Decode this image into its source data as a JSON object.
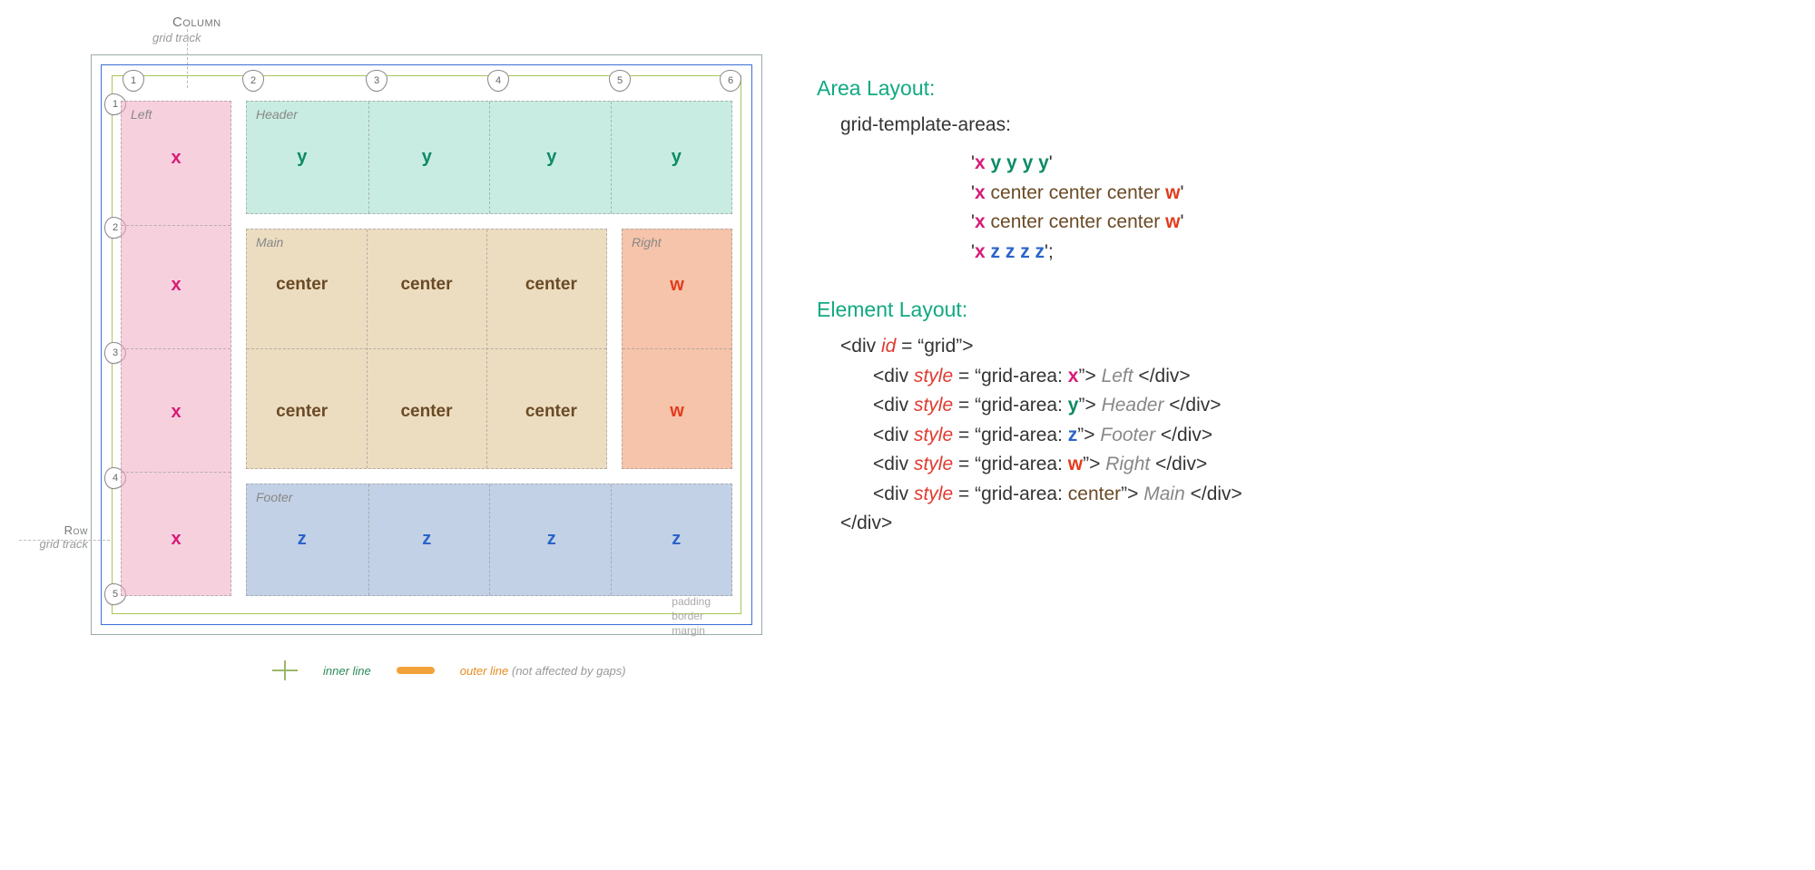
{
  "topLabels": {
    "column": "Column",
    "gridTrack": "grid track"
  },
  "rowLabels": {
    "row": "Row",
    "gridTrack": "grid track"
  },
  "columnNumbers": [
    "1",
    "2",
    "3",
    "4",
    "5",
    "6"
  ],
  "rowNumbers": [
    "1",
    "2",
    "3",
    "4",
    "5"
  ],
  "areas": {
    "left": {
      "title": "Left",
      "letter": "x",
      "rows": 4
    },
    "header": {
      "title": "Header",
      "letter": "y",
      "cols": 4
    },
    "main": {
      "title": "Main",
      "letter": "center",
      "cols": 3,
      "rows": 2
    },
    "right": {
      "title": "Right",
      "letter": "w",
      "rows": 2
    },
    "footer": {
      "title": "Footer",
      "letter": "z",
      "cols": 4
    }
  },
  "boxAnnotations": {
    "padding": "padding",
    "border": "border",
    "margin": "margin"
  },
  "legend": {
    "innerLine": "inner line",
    "outerLine": "outer line",
    "outerNote": "(not affected by gaps)"
  },
  "rightPanel": {
    "areaLayoutHeading": "Area Layout:",
    "gtaProp": "grid-template-areas:",
    "gtaRows": [
      [
        {
          "t": "'",
          "c": ""
        },
        {
          "t": "x",
          "c": "x-col"
        },
        {
          "t": " y y y y",
          "c": "y-col"
        },
        {
          "t": "'",
          "c": ""
        }
      ],
      [
        {
          "t": "'",
          "c": ""
        },
        {
          "t": "x",
          "c": "x-col"
        },
        {
          "t": " center center center ",
          "c": "c-col"
        },
        {
          "t": "w",
          "c": "w-col"
        },
        {
          "t": "'",
          "c": ""
        }
      ],
      [
        {
          "t": "'",
          "c": ""
        },
        {
          "t": "x",
          "c": "x-col"
        },
        {
          "t": " center center center ",
          "c": "c-col"
        },
        {
          "t": "w",
          "c": "w-col"
        },
        {
          "t": "'",
          "c": ""
        }
      ],
      [
        {
          "t": "'",
          "c": ""
        },
        {
          "t": "x",
          "c": "x-col"
        },
        {
          "t": " z z z z",
          "c": "z-col"
        },
        {
          "t": "';",
          "c": ""
        }
      ]
    ],
    "elementLayoutHeading": "Element Layout:",
    "elOpen": "<div ",
    "idAttr": "id",
    "idVal": " = “grid”>",
    "styleAttr": "style",
    "childLines": [
      {
        "area": "x",
        "areaClass": "x-col",
        "label": "Left"
      },
      {
        "area": "y",
        "areaClass": "y-col",
        "label": "Header"
      },
      {
        "area": "z",
        "areaClass": "z-col",
        "label": "Footer"
      },
      {
        "area": "w",
        "areaClass": "w-col",
        "label": "Right"
      },
      {
        "area": "center",
        "areaClass": "c-col",
        "label": "Main"
      }
    ],
    "stylePrefix": " = “grid-area: ",
    "styleSuffix": "”> ",
    "closeChild": " </div>",
    "closeParent": "</div>"
  }
}
